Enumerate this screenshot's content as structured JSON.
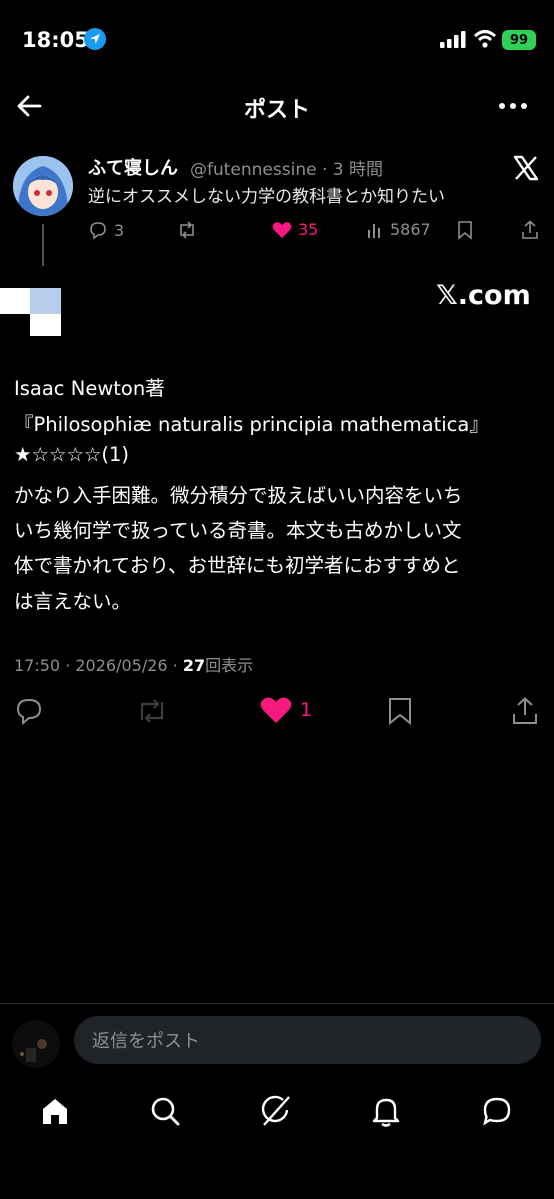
{
  "status_bar": {
    "time": "18:05",
    "battery": "99"
  },
  "header": {
    "title": "ポスト"
  },
  "quoted_post": {
    "name": "ふて寝しん",
    "handle_time": "@futennessine · 3 時間",
    "text": "逆にオススメしない力学の教科書とか知りたい",
    "replies": "3",
    "likes": "35",
    "views": "5867"
  },
  "embed": {
    "domain": "𝕏.com"
  },
  "post": {
    "lines": [
      "Isaac Newton著",
      "『Philosophiæ naturalis principia mathematica』",
      "★☆☆☆☆(1)",
      "かなり入手困難。微分積分で扱えばいい内容をいち",
      "いち幾何学で扱っている奇書。本文も古めかしい文",
      "体で書かれており、お世辞にも初学者におすすめと",
      "は言えない。"
    ],
    "timestamp": "17:50 · 2026/05/26 · ",
    "views_count": "27",
    "views_label": "回表示",
    "likes": "1"
  },
  "reply_bar": {
    "placeholder": "返信をポスト"
  },
  "colors": {
    "like": "#f91880",
    "accent": "#1d9bf0",
    "muted": "#8b8f94"
  },
  "icons": [
    "back-arrow-icon",
    "more-icon",
    "x-logo-icon",
    "reply-icon",
    "retweet-icon",
    "heart-icon",
    "views-icon",
    "bookmark-icon",
    "share-icon",
    "home-icon",
    "search-icon",
    "grok-icon",
    "bell-icon",
    "messages-icon"
  ]
}
